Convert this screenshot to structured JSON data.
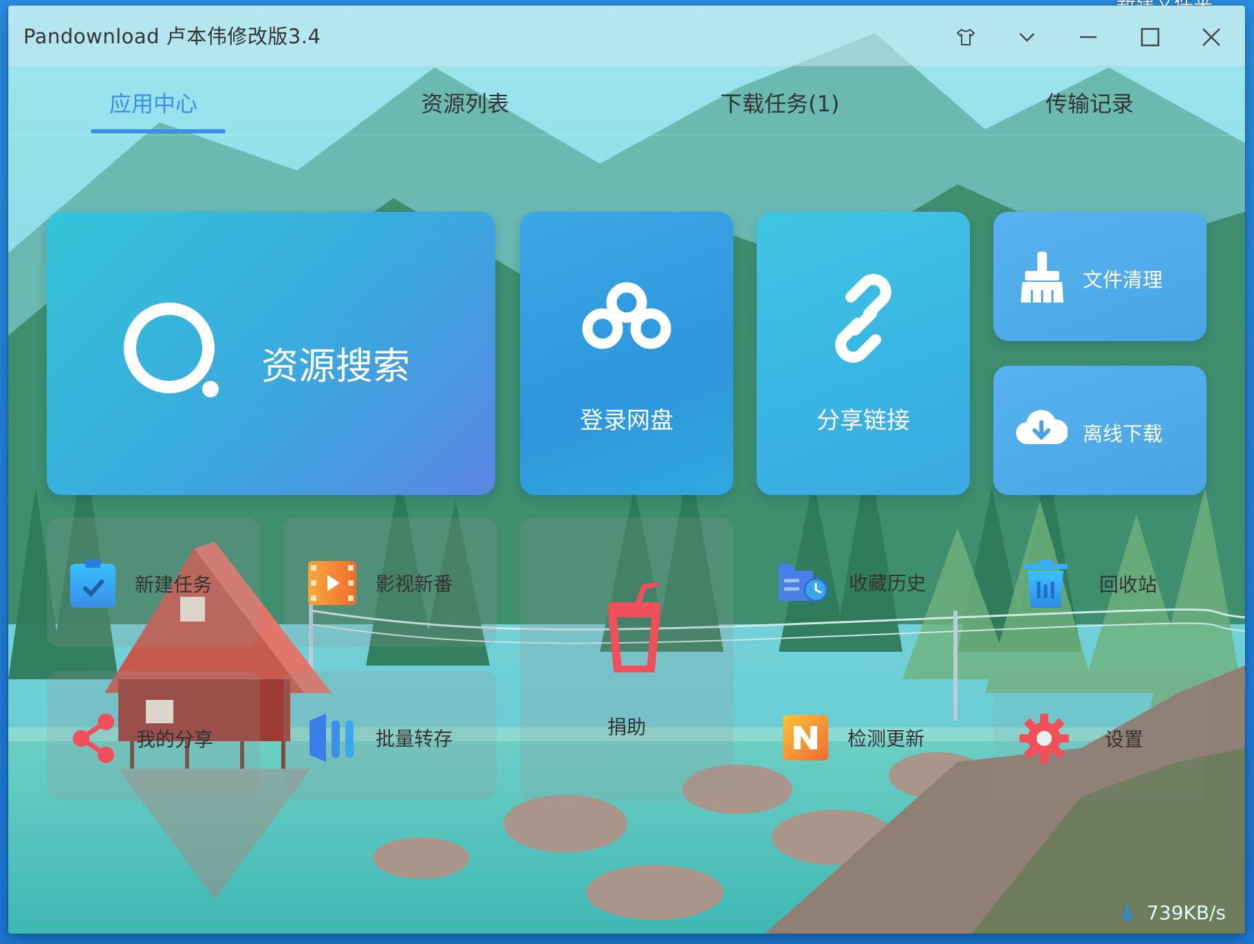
{
  "desktop": {
    "label": "新建文件夹"
  },
  "window": {
    "title": "Pandownload 卢本伟修改版3.4"
  },
  "tabs": [
    {
      "label": "应用中心",
      "active": true
    },
    {
      "label": "资源列表",
      "active": false
    },
    {
      "label": "下载任务(1)",
      "active": false
    },
    {
      "label": "传输记录",
      "active": false
    }
  ],
  "tiles": {
    "search": "资源搜索",
    "login": "登录网盘",
    "share_link": "分享链接",
    "cleanup": "文件清理",
    "offline": "离线下载"
  },
  "small": {
    "new_task": "新建任务",
    "video": "影视新番",
    "donate": "捐助",
    "favorites": "收藏历史",
    "recycle": "回收站",
    "my_share": "我的分享",
    "batch": "批量转存",
    "update": "检测更新",
    "settings": "设置"
  },
  "status": {
    "speed": "739KB/s"
  },
  "colors": {
    "accent": "#3a8ee6",
    "donate": "#f0505a"
  }
}
